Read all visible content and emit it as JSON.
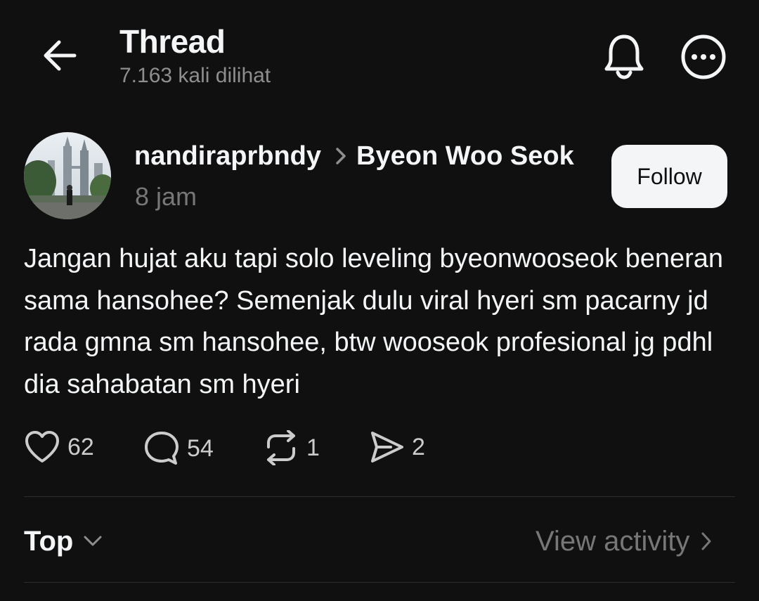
{
  "header": {
    "title": "Thread",
    "views": "7.163 kali dilihat"
  },
  "post": {
    "author": "nandiraprbndy",
    "reply_to": "Byeon Woo Seok",
    "time": "8 jam",
    "follow_label": "Follow",
    "text": "Jangan hujat aku tapi solo leveling byeonwooseok beneran sama hansohee? Semenjak dulu viral hyeri sm pacarny jd rada gmna sm hansohee, btw wooseok profesional jg pdhl dia sahabatan sm hyeri",
    "likes": "62",
    "replies": "54",
    "reposts": "1",
    "shares": "2"
  },
  "replies_bar": {
    "sort_label": "Top",
    "activity_label": "View activity"
  },
  "icons": {
    "back": "arrow-left-icon",
    "bell": "bell-icon",
    "more": "more-icon",
    "like": "heart-icon",
    "reply": "comment-icon",
    "repost": "repost-icon",
    "share": "send-icon"
  },
  "colors": {
    "background": "#101010",
    "text": "#f3f5f7",
    "secondary": "#8e8e8e",
    "button_bg": "#f3f5f7"
  }
}
